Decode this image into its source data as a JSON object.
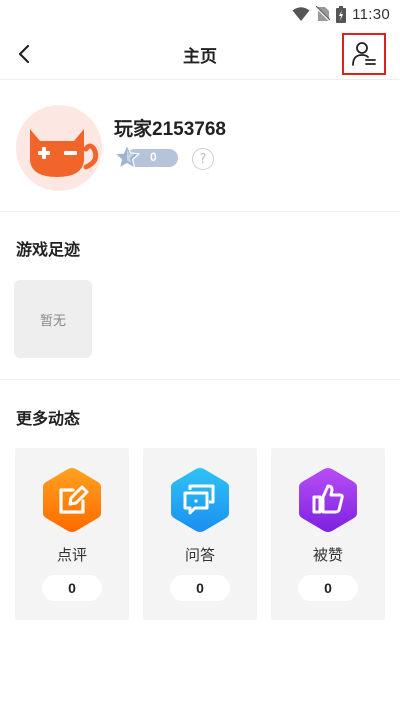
{
  "status_bar": {
    "time": "11:30"
  },
  "nav": {
    "title": "主页"
  },
  "profile": {
    "username": "玩家2153768",
    "level": "0",
    "help_glyph": "?"
  },
  "footprint": {
    "title": "游戏足迹",
    "empty_text": "暂无"
  },
  "activity": {
    "title": "更多动态",
    "cards": [
      {
        "label": "点评",
        "count": "0",
        "icon": "edit-icon",
        "color_top": "#ffa21f",
        "color_bottom": "#ff6a00"
      },
      {
        "label": "问答",
        "count": "0",
        "icon": "chat-icon",
        "color_top": "#2fc3f5",
        "color_bottom": "#1a8ff0"
      },
      {
        "label": "被赞",
        "count": "0",
        "icon": "thumb-up-icon",
        "color_top": "#b84ef5",
        "color_bottom": "#7d22e0"
      }
    ]
  },
  "colors": {
    "highlight_box": "#e02020",
    "avatar_bg": "#fde7e2",
    "cat": "#f2652a"
  }
}
